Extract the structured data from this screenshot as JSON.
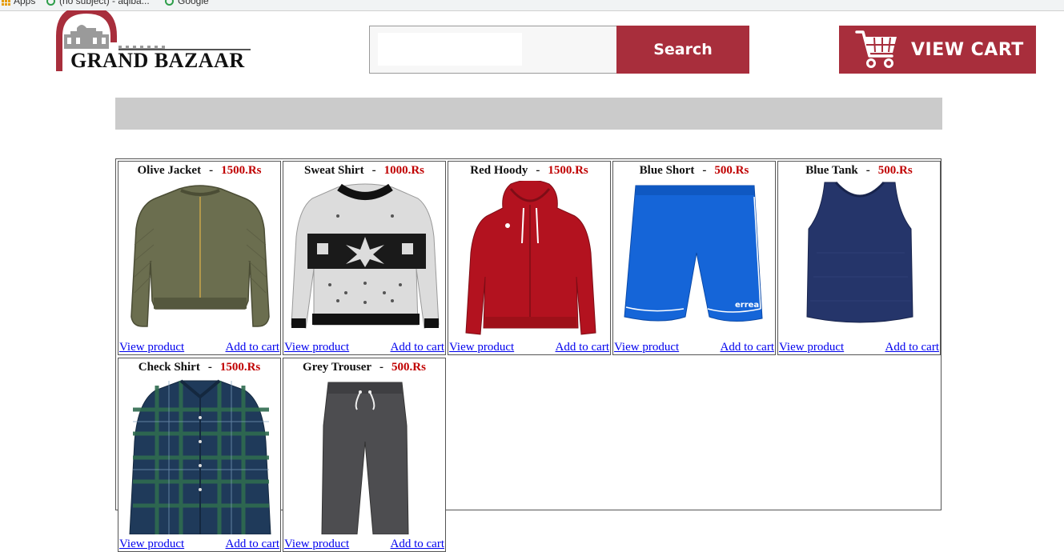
{
  "browser": {
    "bookmarks": [
      "Apps",
      "(no subject) - aqiba...",
      "Google"
    ]
  },
  "header": {
    "logo_text": "GRAND BAZAAR",
    "search": {
      "placeholder": "",
      "value": "",
      "button_label": "Search"
    },
    "cart_label": "VIEW CART"
  },
  "colors": {
    "accent": "#a82e3c",
    "price": "#c00000",
    "bar": "#cbcbcb",
    "link": "#0000ee"
  },
  "products": [
    {
      "name": "Olive Jacket",
      "separator": "-",
      "price": "1500.Rs",
      "view_label": "View product",
      "add_label": "Add to cart",
      "icon": "olive-jacket-image"
    },
    {
      "name": "Sweat Shirt",
      "separator": "-",
      "price": "1000.Rs",
      "view_label": "View product",
      "add_label": "Add to cart",
      "icon": "sweat-shirt-image"
    },
    {
      "name": "Red Hoody",
      "separator": "-",
      "price": "1500.Rs",
      "view_label": "View product",
      "add_label": "Add to cart",
      "icon": "red-hoody-image"
    },
    {
      "name": "Blue Short",
      "separator": "-",
      "price": "500.Rs",
      "view_label": "View product",
      "add_label": "Add to cart",
      "icon": "blue-short-image"
    },
    {
      "name": "Blue Tank",
      "separator": "-",
      "price": "500.Rs",
      "view_label": "View product",
      "add_label": "Add to cart",
      "icon": "blue-tank-image"
    },
    {
      "name": "Check Shirt",
      "separator": "-",
      "price": "1500.Rs",
      "view_label": "View product",
      "add_label": "Add to cart",
      "icon": "check-shirt-image"
    },
    {
      "name": "Grey Trouser",
      "separator": "-",
      "price": "500.Rs",
      "view_label": "View product",
      "add_label": "Add to cart",
      "icon": "grey-trouser-image"
    }
  ]
}
